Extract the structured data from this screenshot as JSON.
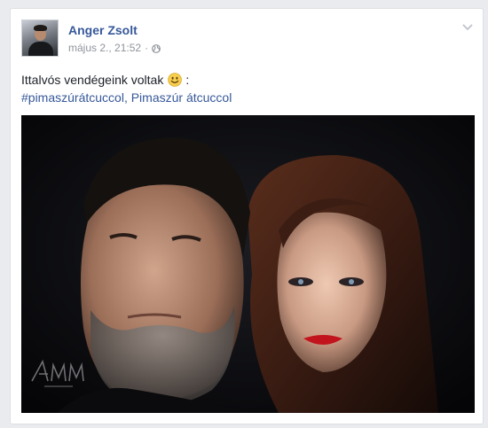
{
  "post": {
    "author": "Anger Zsolt",
    "date": "május 2., 21:52",
    "separator": "·",
    "text": "Ittalvós vendégeink voltak",
    "text_suffix": " :",
    "hashtag": "#pimaszúrátcuccol",
    "hashtag_separator": ",",
    "page_link": "Pimaszúr átcuccol",
    "photo_alt": "Két ember portréja sötét háttér előtt"
  },
  "colors": {
    "link": "#365899",
    "text": "#1d2129",
    "meta": "#90949c",
    "background": "#e9ebee"
  },
  "icons": {
    "privacy": "globe-icon",
    "menu": "chevron-down-icon",
    "emoji": "smiley-icon"
  }
}
